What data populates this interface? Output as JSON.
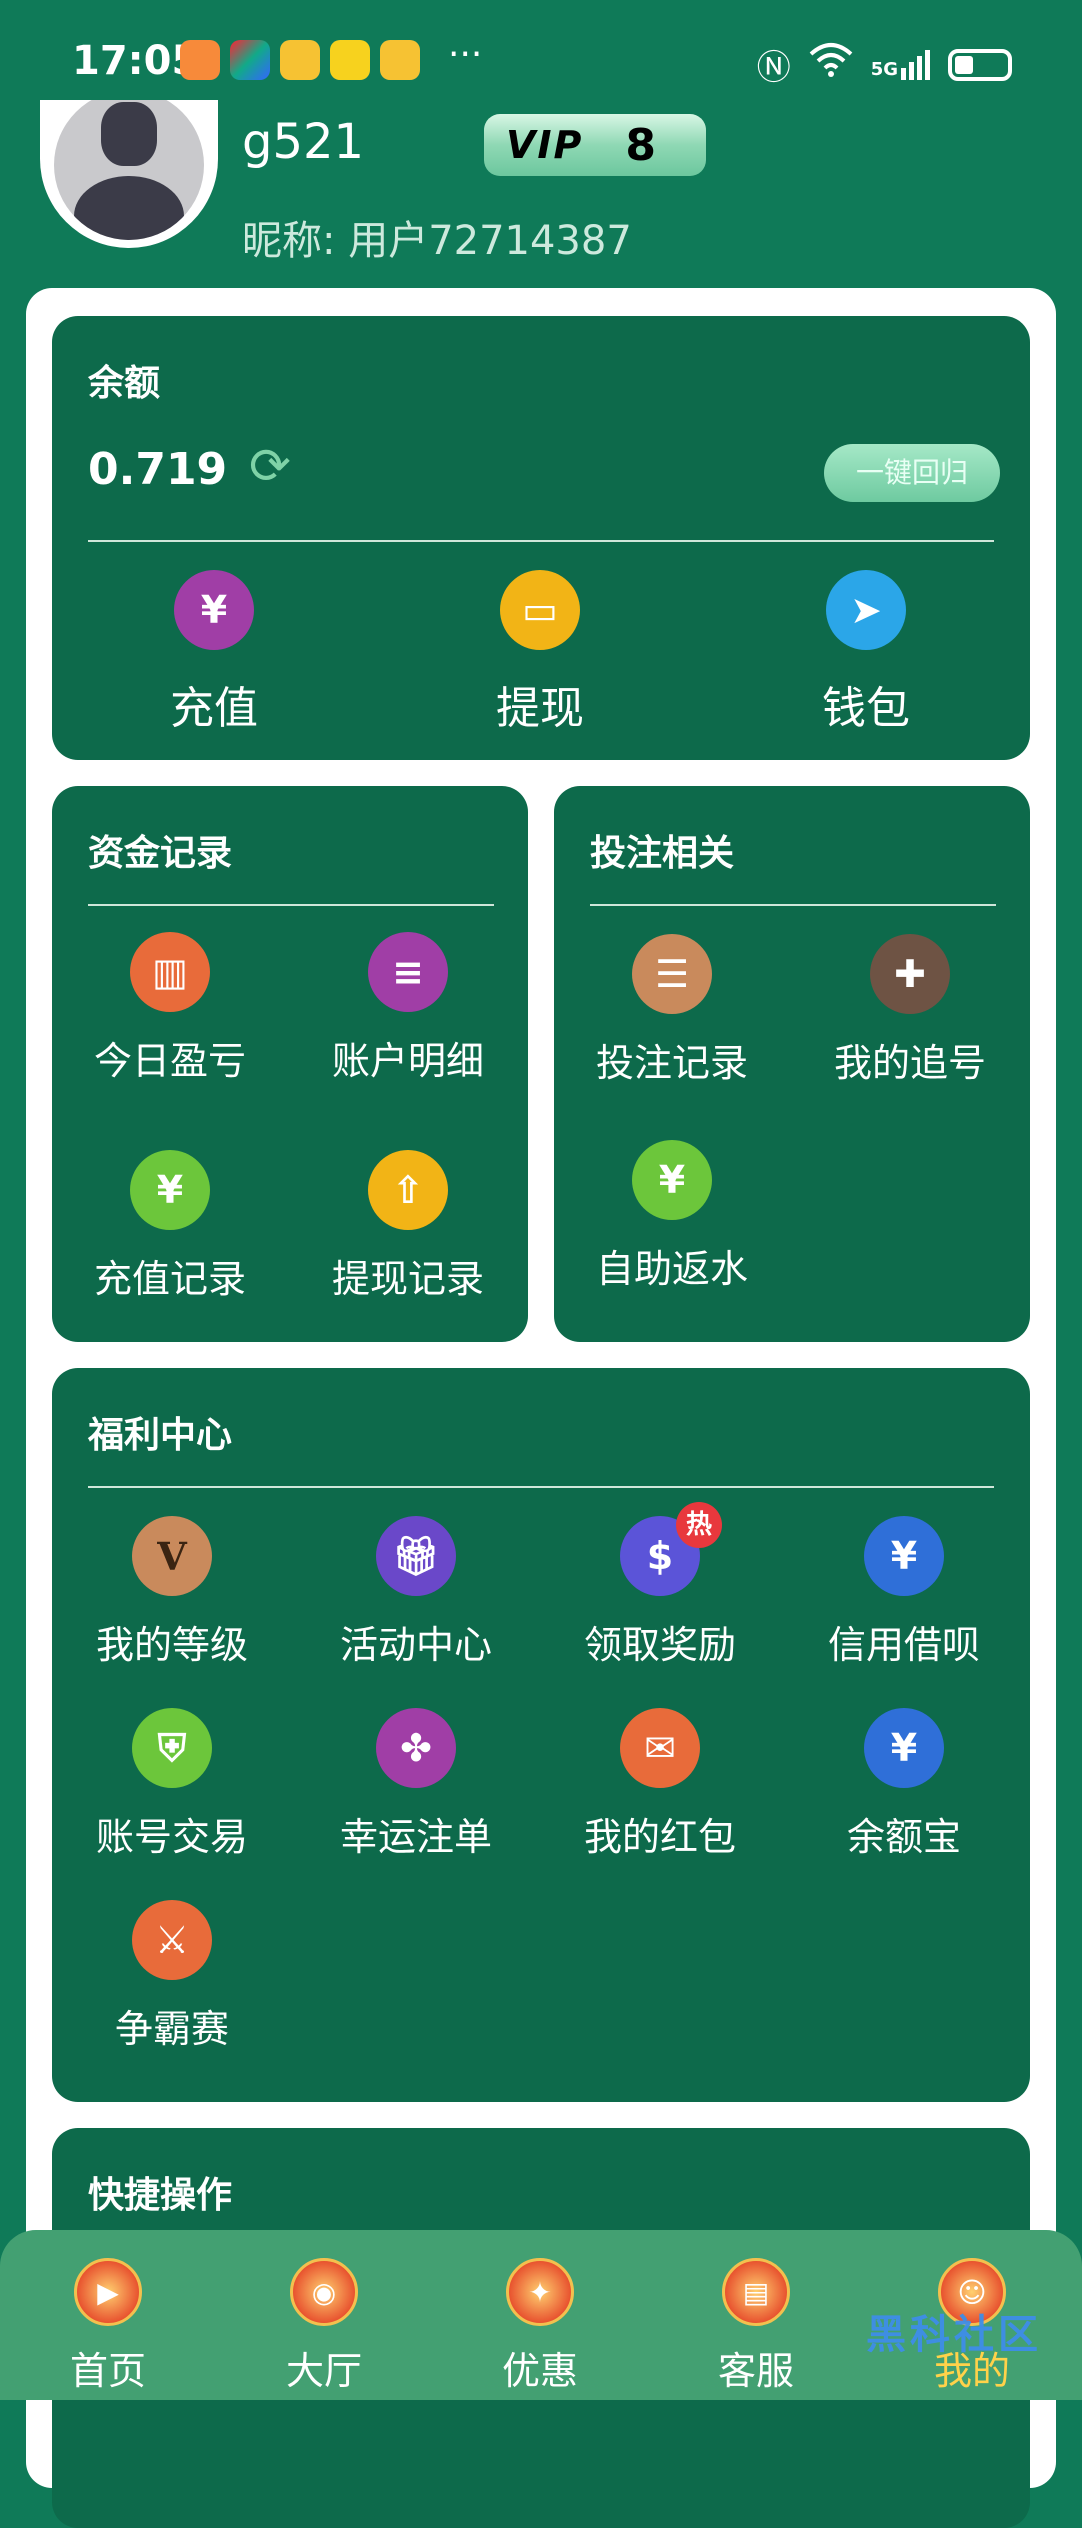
{
  "status_bar": {
    "time": "17:05",
    "network_label": "5G",
    "dots": "···"
  },
  "profile": {
    "username": "g521",
    "vip_label": "VIP",
    "vip_level": "8",
    "nickname": "昵称: 用户72714387"
  },
  "balance_card": {
    "title": "余额",
    "value": "0.719",
    "recall_button": "一键回归",
    "actions": [
      {
        "label": "充值",
        "icon": "piggy-bank-icon",
        "color": "#a03ea6"
      },
      {
        "label": "提现",
        "icon": "wallet-icon",
        "color": "#f2b416"
      },
      {
        "label": "钱包",
        "icon": "paper-plane-icon",
        "color": "#2ba6e8"
      }
    ]
  },
  "funds_card": {
    "title": "资金记录",
    "items": [
      {
        "label": "今日盈亏",
        "icon": "chart-icon",
        "color": "#e86b3a"
      },
      {
        "label": "账户明细",
        "icon": "ledger-icon",
        "color": "#a03ea6"
      },
      {
        "label": "充值记录",
        "icon": "yuan-note-icon",
        "color": "#6cc63b"
      },
      {
        "label": "提现记录",
        "icon": "withdraw-box-icon",
        "color": "#f2b416"
      }
    ]
  },
  "bet_card": {
    "title": "投注相关",
    "items": [
      {
        "label": "投注记录",
        "icon": "list-icon",
        "color": "#c98a5c"
      },
      {
        "label": "我的追号",
        "icon": "doc-plus-icon",
        "color": "#6e5344"
      },
      {
        "label": "自助返水",
        "icon": "money-bag-icon",
        "color": "#6cc63b"
      }
    ]
  },
  "welfare_card": {
    "title": "福利中心",
    "items": [
      {
        "label": "我的等级",
        "icon": "level-v-icon",
        "color": "#c98a5c"
      },
      {
        "label": "活动中心",
        "icon": "gift-icon",
        "color": "#6a48c9"
      },
      {
        "label": "领取奖励",
        "icon": "dollar-hand-icon",
        "color": "#5b54d8",
        "badge": "热"
      },
      {
        "label": "信用借呗",
        "icon": "yuan-hand-icon",
        "color": "#2f6fd8"
      },
      {
        "label": "账号交易",
        "icon": "shield-icon",
        "color": "#6cc63b"
      },
      {
        "label": "幸运注单",
        "icon": "clover-icon",
        "color": "#a03ea6"
      },
      {
        "label": "我的红包",
        "icon": "red-envelope-icon",
        "color": "#e86b3a"
      },
      {
        "label": "余额宝",
        "icon": "yuan-bag-icon",
        "color": "#2f6fd8"
      },
      {
        "label": "争霸赛",
        "icon": "crossed-swords-icon",
        "color": "#e86b3a"
      }
    ]
  },
  "quick_card": {
    "title": "快捷操作"
  },
  "bottom_nav": {
    "items": [
      {
        "label": "首页",
        "icon": "home-icon",
        "active": false
      },
      {
        "label": "大厅",
        "icon": "drum-icon",
        "active": false
      },
      {
        "label": "优惠",
        "icon": "gift-bag-icon",
        "active": false
      },
      {
        "label": "客服",
        "icon": "service-icon",
        "active": false
      },
      {
        "label": "我的",
        "icon": "lion-icon",
        "active": true
      }
    ],
    "watermark": "黑科社区"
  }
}
